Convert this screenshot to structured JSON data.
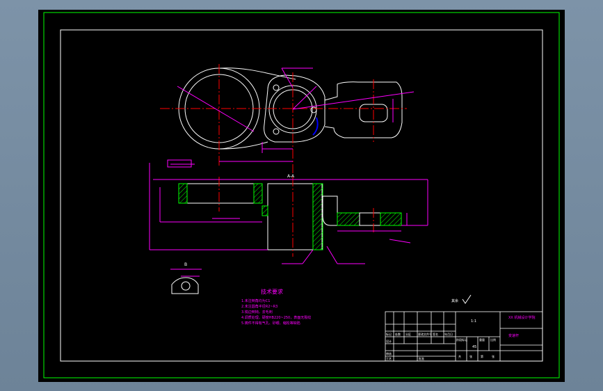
{
  "colors": {
    "background": "#000000",
    "outer_frame": "#00ff00",
    "border": "#ffffff",
    "dimension": "#ff00ff",
    "center_line": "#ff0000",
    "hatch": "#00ff00",
    "accent": "#0000ff"
  },
  "labels": {
    "section_aa": "A-A",
    "view_b": "B",
    "notes_title": "技术要求",
    "surface_mark": "其余"
  },
  "notes": [
    "1.未注倒角均为C1",
    "2.未注圆角半径R2~R3",
    "3.锐边倒钝，去毛刺",
    "4.调质处理，硬度HB220~250，表面无裂纹",
    "5.铸件不得有气孔、砂眼、缩松等缺陷"
  ],
  "title_block": {
    "scale": "1:1",
    "school": "XX 机械设计学院",
    "drawing_name": "变速杆",
    "material": "45",
    "row_labels": [
      "标记",
      "处数",
      "分区",
      "更改文件号",
      "签名",
      "年月日"
    ],
    "role_labels": [
      "设计",
      "审核",
      "工艺",
      "批准"
    ],
    "stage_labels": [
      "阶段标记",
      "重量",
      "比例"
    ],
    "sheet_labels": [
      "共",
      "张",
      "第",
      "张"
    ]
  }
}
